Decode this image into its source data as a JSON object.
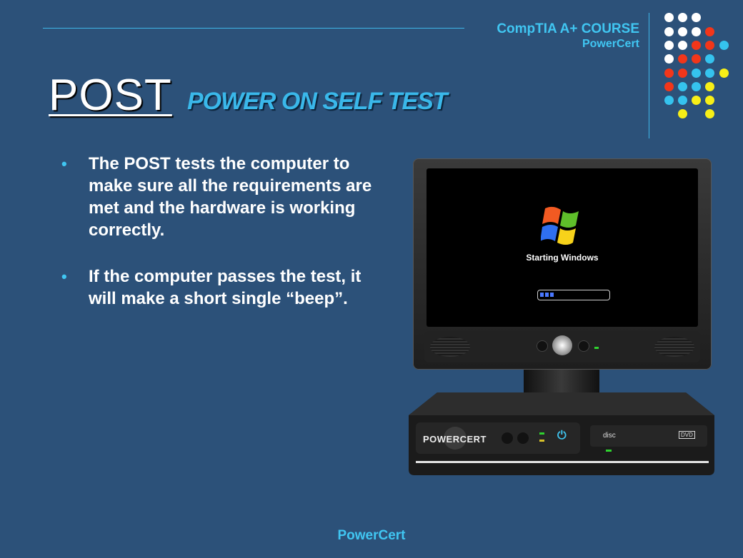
{
  "header": {
    "course_title": "CompTIA A+ COURSE",
    "brand": "PowerCert"
  },
  "slide": {
    "title": "POST",
    "subtitle": "POWER ON SELF TEST",
    "bullets": [
      "The POST tests the computer to make sure all the requirements are met and the hardware is working correctly.",
      "If the computer passes the test, it will make a short single “beep”."
    ],
    "bullet_symbol": "•"
  },
  "illustration": {
    "screen_text": "Starting Windows",
    "base_brand": "POWERCERT",
    "disc_label": "disc",
    "dvd_label": "DVD",
    "power_icon": "power-icon",
    "windows_logo": "windows-logo-icon"
  },
  "footer": {
    "text": "PowerCert"
  },
  "colors": {
    "background": "#2c5179",
    "accent_blue": "#40c6f2",
    "title_white": "#ffffff",
    "dot_white": "#ffffff",
    "dot_red": "#f2361a",
    "dot_cyan": "#35c3ee",
    "dot_yellow": "#f7ef17"
  }
}
